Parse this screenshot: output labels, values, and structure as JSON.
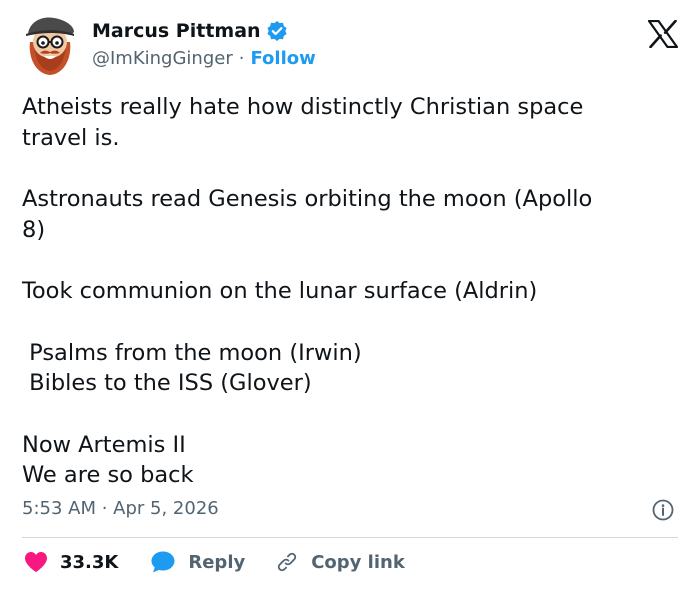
{
  "author": {
    "display_name": "Marcus Pittman",
    "handle": "@ImKingGinger",
    "separator": "·",
    "follow_label": "Follow"
  },
  "tweet": {
    "paragraphs": [
      [
        "Atheists really hate how distinctly Christian space",
        "travel is."
      ],
      [
        "Astronauts read Genesis orbiting the moon (Apollo",
        "8)"
      ],
      [
        "Took communion on the lunar surface (Aldrin)"
      ],
      [
        " Psalms from the moon (Irwin)",
        " Bibles to the ISS (Glover)"
      ],
      [
        "Now Artemis II",
        "We are so back"
      ]
    ],
    "timestamp": "5:53 AM · Apr 5, 2026"
  },
  "actions": {
    "likes": "33.3K",
    "reply": "Reply",
    "copy_link": "Copy link"
  },
  "colors": {
    "accent": "#1d9bf0",
    "like": "#f91880",
    "text": "#0f1419",
    "muted": "#536471"
  },
  "icons": [
    "avatar",
    "verified-badge-icon",
    "x-logo-icon",
    "info-icon",
    "heart-icon",
    "reply-bubble-icon",
    "link-icon"
  ]
}
